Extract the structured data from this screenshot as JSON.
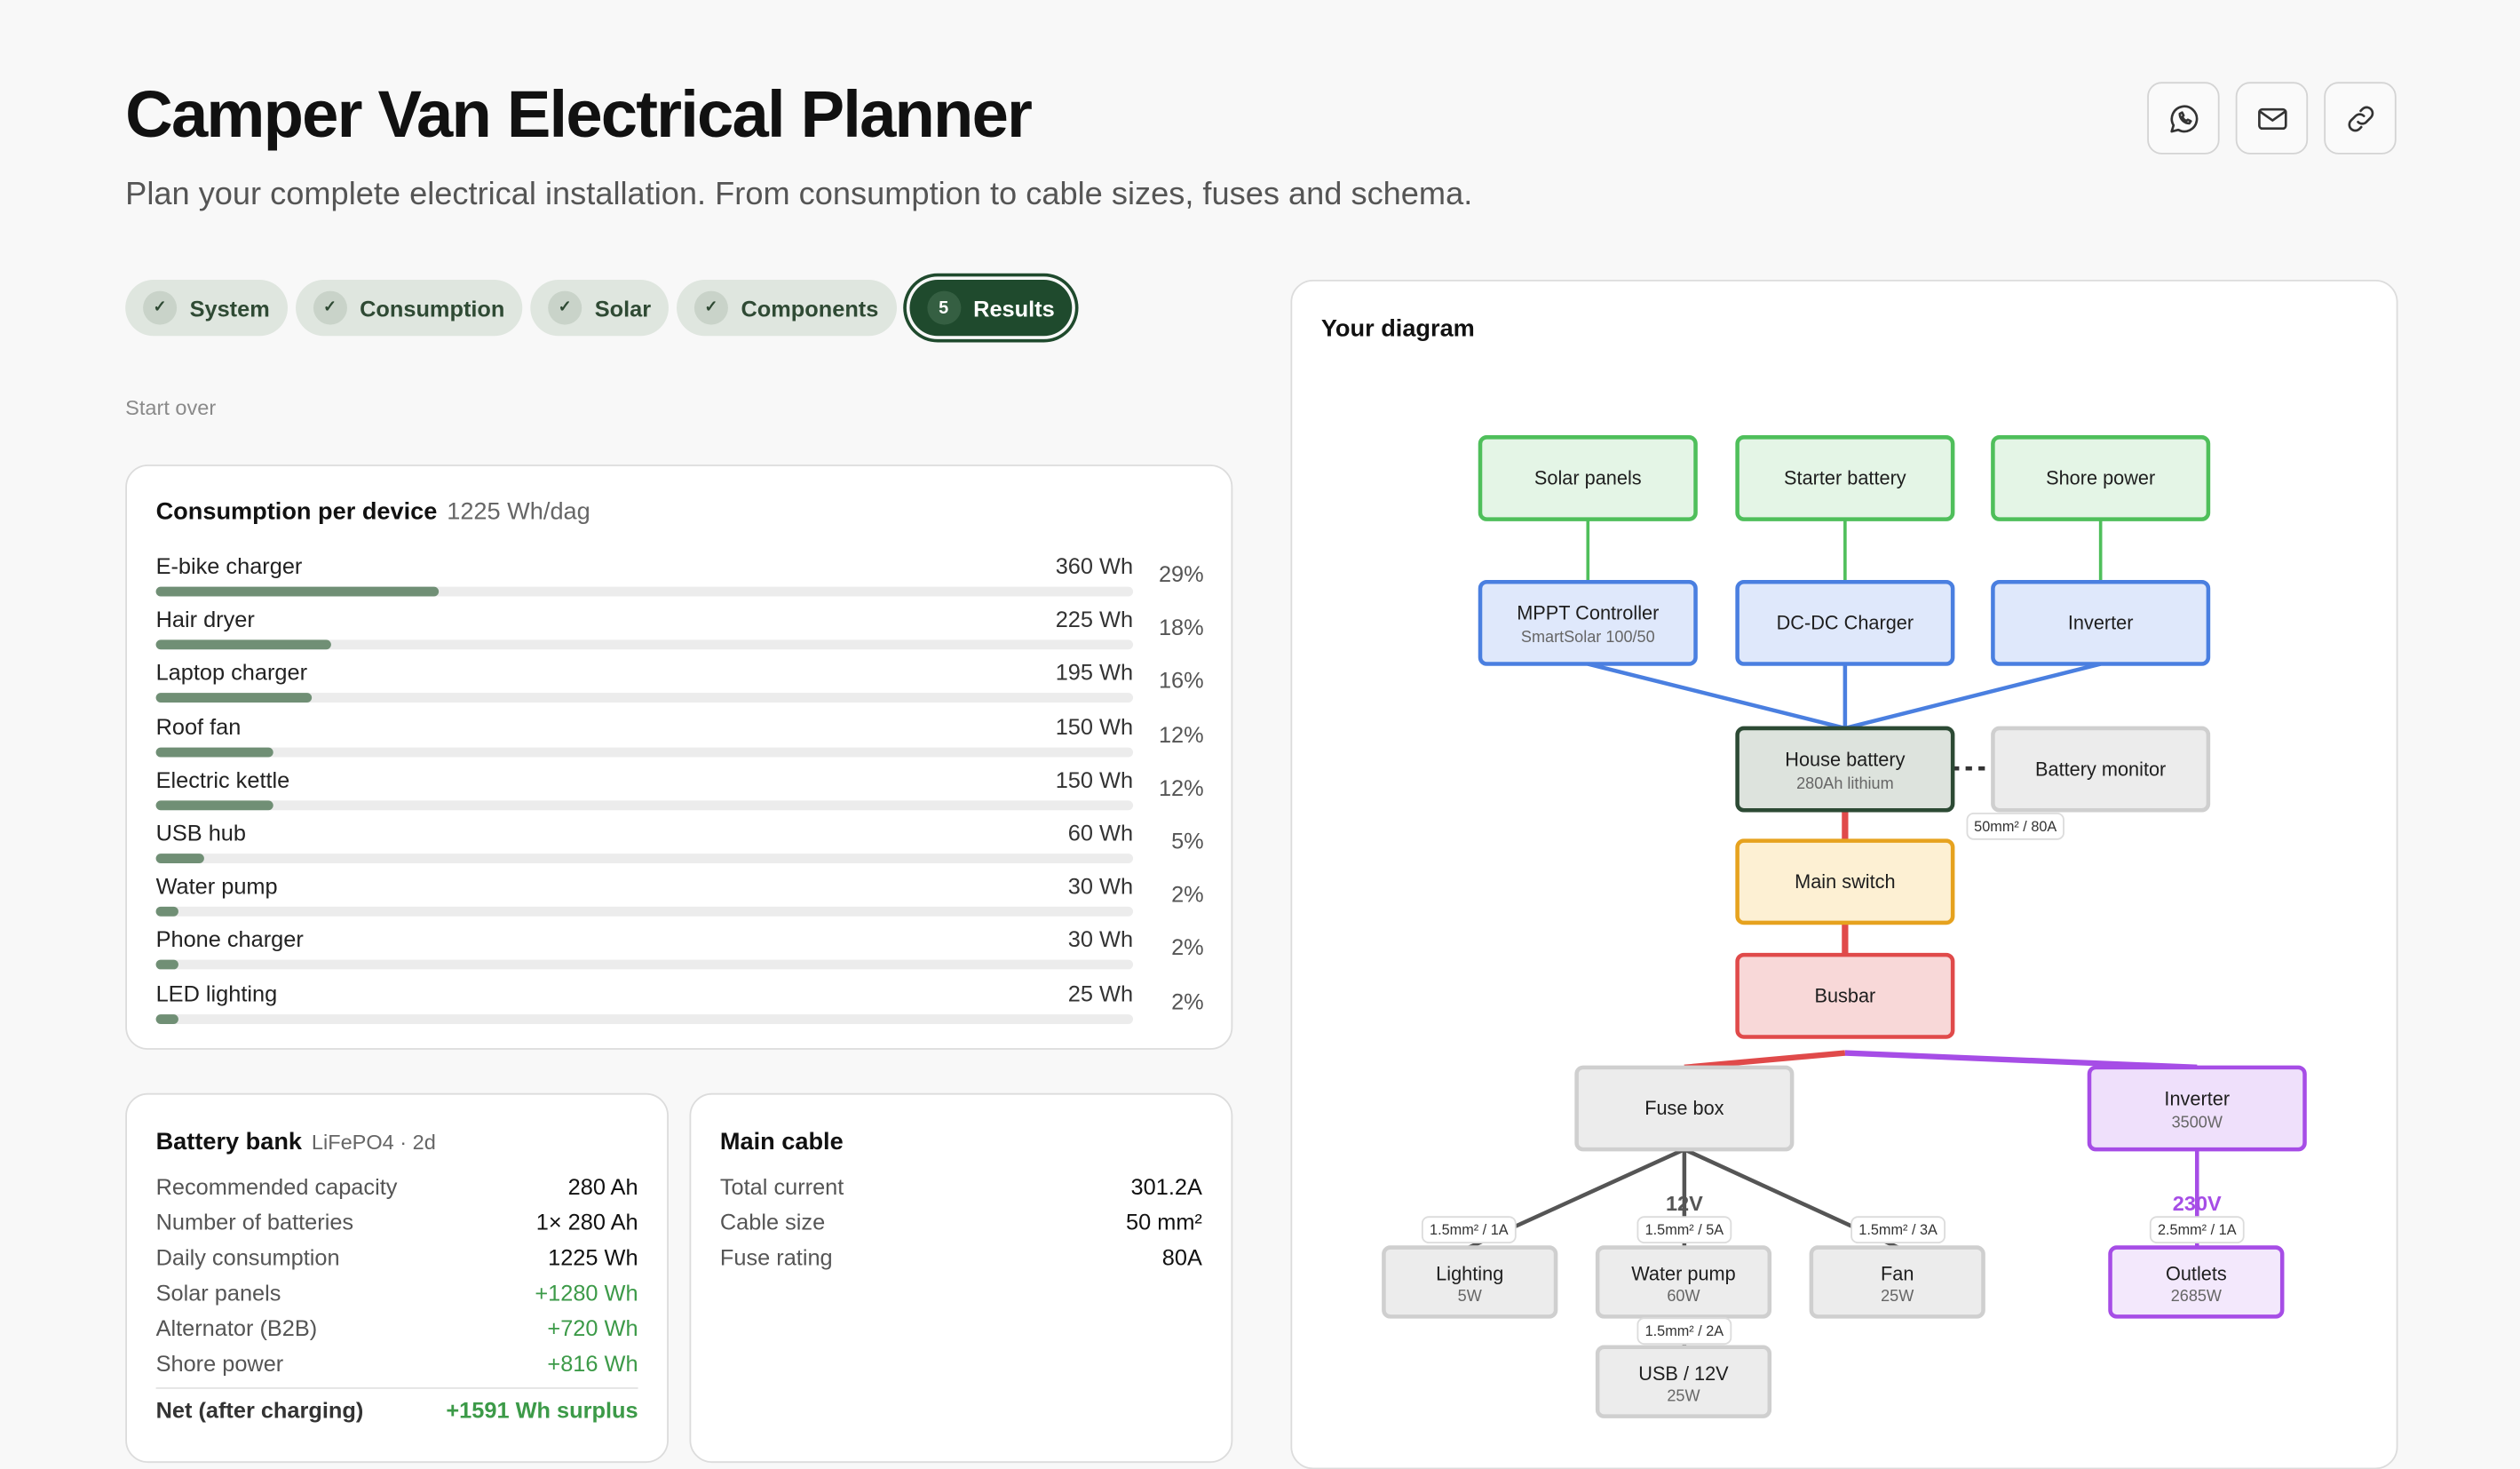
{
  "header": {
    "title": "Camper Van Electrical Planner",
    "subtitle": "Plan your complete electrical installation. From consumption to cable sizes, fuses and schema."
  },
  "share": [
    {
      "name": "whatsapp-share-button",
      "icon": "whatsapp-icon"
    },
    {
      "name": "email-share-button",
      "icon": "mail-icon"
    },
    {
      "name": "copy-link-button",
      "icon": "link-icon"
    }
  ],
  "steps": [
    {
      "label": "System",
      "marker": "✓",
      "status": "done"
    },
    {
      "label": "Consumption",
      "marker": "✓",
      "status": "done"
    },
    {
      "label": "Solar",
      "marker": "✓",
      "status": "done"
    },
    {
      "label": "Components",
      "marker": "✓",
      "status": "done"
    },
    {
      "label": "Results",
      "marker": "5",
      "status": "active"
    }
  ],
  "start_over": "Start over",
  "consumption": {
    "title": "Consumption per device",
    "total": "1225 Wh/dag",
    "devices": [
      {
        "name": "E-bike charger",
        "wh": "360 Wh",
        "pct": "29%",
        "share": 0.29
      },
      {
        "name": "Hair dryer",
        "wh": "225 Wh",
        "pct": "18%",
        "share": 0.18
      },
      {
        "name": "Laptop charger",
        "wh": "195 Wh",
        "pct": "16%",
        "share": 0.16
      },
      {
        "name": "Roof fan",
        "wh": "150 Wh",
        "pct": "12%",
        "share": 0.12
      },
      {
        "name": "Electric kettle",
        "wh": "150 Wh",
        "pct": "12%",
        "share": 0.12
      },
      {
        "name": "USB hub",
        "wh": "60 Wh",
        "pct": "5%",
        "share": 0.05
      },
      {
        "name": "Water pump",
        "wh": "30 Wh",
        "pct": "2%",
        "share": 0.02
      },
      {
        "name": "Phone charger",
        "wh": "30 Wh",
        "pct": "2%",
        "share": 0.02
      },
      {
        "name": "LED lighting",
        "wh": "25 Wh",
        "pct": "2%",
        "share": 0.02
      }
    ]
  },
  "battery": {
    "title": "Battery bank",
    "subtitle": "LiFePO4 · 2d",
    "rows": [
      {
        "key": "Recommended capacity",
        "value": "280 Ah",
        "style": ""
      },
      {
        "key": "Number of batteries",
        "value": "1× 280 Ah",
        "style": ""
      },
      {
        "key": "Daily consumption",
        "value": "1225 Wh",
        "style": ""
      },
      {
        "key": "Solar panels",
        "value": "+1280 Wh",
        "style": "green"
      },
      {
        "key": "Alternator (B2B)",
        "value": "+720 Wh",
        "style": "green"
      },
      {
        "key": "Shore power",
        "value": "+816 Wh",
        "style": "green"
      }
    ],
    "net_label": "Net (after charging)",
    "net_value": "+1591 Wh surplus"
  },
  "main_cable": {
    "title": "Main cable",
    "rows": [
      {
        "key": "Total current",
        "value": "301.2A"
      },
      {
        "key": "Cable size",
        "value": "50 mm²"
      },
      {
        "key": "Fuse rating",
        "value": "80A"
      }
    ]
  },
  "diagram": {
    "title": "Your diagram",
    "colors": {
      "green": "#4fbf5b",
      "blue": "#4a7fe0",
      "red": "#e04a4a",
      "purple": "#a64de6",
      "dark": "#555555",
      "amber": "#e6a21e"
    },
    "nodes": [
      {
        "id": "solar-panels",
        "label": "Solar panels",
        "sub": "",
        "style": "green"
      },
      {
        "id": "starter-battery",
        "label": "Starter battery",
        "sub": "",
        "style": "green"
      },
      {
        "id": "shore-power",
        "label": "Shore power",
        "sub": "",
        "style": "green"
      },
      {
        "id": "mppt-controller",
        "label": "MPPT Controller",
        "sub": "SmartSolar 100/50",
        "style": "blue"
      },
      {
        "id": "dc-dc-charger",
        "label": "DC-DC Charger",
        "sub": "",
        "style": "blue"
      },
      {
        "id": "inverter-charger",
        "label": "Inverter",
        "sub": "",
        "style": "blue"
      },
      {
        "id": "house-battery",
        "label": "House battery",
        "sub": "280Ah lithium",
        "style": "battery"
      },
      {
        "id": "battery-monitor",
        "label": "Battery monitor",
        "sub": "",
        "style": "gray"
      },
      {
        "id": "main-switch",
        "label": "Main switch",
        "sub": "",
        "style": "amber"
      },
      {
        "id": "busbar",
        "label": "Busbar",
        "sub": "",
        "style": "red"
      },
      {
        "id": "fuse-box",
        "label": "Fuse box",
        "sub": "",
        "style": "gray"
      },
      {
        "id": "inverter",
        "label": "Inverter",
        "sub": "3500W",
        "style": "purple"
      },
      {
        "id": "lighting",
        "label": "Lighting",
        "sub": "5W",
        "style": "gray"
      },
      {
        "id": "water-pump",
        "label": "Water pump",
        "sub": "60W",
        "style": "gray"
      },
      {
        "id": "fan",
        "label": "Fan",
        "sub": "25W",
        "style": "gray"
      },
      {
        "id": "outlets",
        "label": "Outlets",
        "sub": "2685W",
        "style": "purplelight"
      },
      {
        "id": "usb-12v",
        "label": "USB / 12V",
        "sub": "25W",
        "style": "gray"
      }
    ],
    "cable_tags": {
      "main": "50mm² / 80A",
      "lighting": "1.5mm² / 1A",
      "water_pump": "1.5mm² / 5A",
      "fan": "1.5mm² / 3A",
      "outlets": "2.5mm² / 1A",
      "usb": "1.5mm² / 2A"
    },
    "voltage_dc": "12V",
    "voltage_ac": "230V"
  }
}
